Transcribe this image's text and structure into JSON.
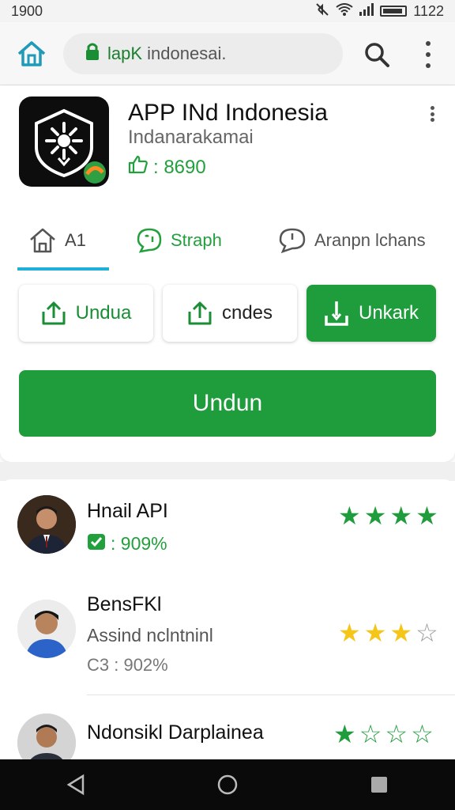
{
  "status": {
    "time_left": "1900",
    "time_right": "1122"
  },
  "toolbar": {
    "url_prefix": "lapK",
    "url_domain": "indonesai.",
    "url_full": "lapK indonesai."
  },
  "app": {
    "title": "APP INd Indonesia",
    "subtitle": "Indanarakamai",
    "rating": ": 8690"
  },
  "tabs": [
    {
      "label": "A1"
    },
    {
      "label": "Straph"
    },
    {
      "label": "Aranpn lchans"
    }
  ],
  "actions": {
    "btn1": "Undua",
    "btn2": "cndes",
    "btn3": "Unkark",
    "primary": "Undun"
  },
  "reviews": [
    {
      "name": "Hnail API",
      "meta": ": 909%",
      "stars_full": 4,
      "stars_total": 4,
      "star_color": "#1f9d3c"
    },
    {
      "name": "BensFKl",
      "text": "Assind nclntninl",
      "pct": "C3 : 902%",
      "stars_full": 3,
      "stars_total": 4,
      "star_color": "#f5c518"
    },
    {
      "name": "Ndonsikl Darplainea",
      "stars_full": 1,
      "stars_total": 4,
      "star_color": "#1f9d3c"
    }
  ],
  "colors": {
    "accent": "#1f9d3c",
    "tab_indicator": "#1fb0d8"
  }
}
